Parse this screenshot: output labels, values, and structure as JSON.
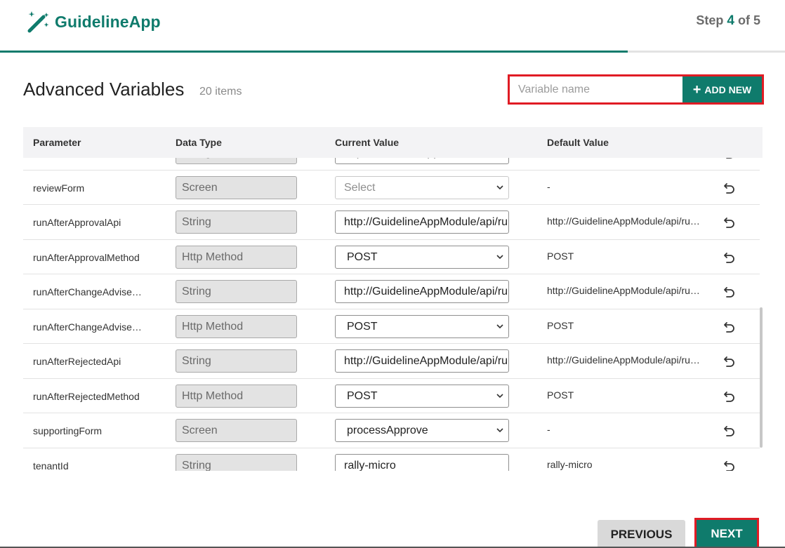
{
  "header": {
    "app_name": "GuidelineApp",
    "step_prefix": "Step",
    "step_current": "4",
    "step_sep": "of",
    "step_total": "5",
    "progress_fraction": 0.8
  },
  "page": {
    "title": "Advanced Variables",
    "count": "20 items"
  },
  "add_new": {
    "placeholder": "Variable name",
    "button_label": "ADD NEW"
  },
  "table": {
    "columns": [
      "Parameter",
      "Data Type",
      "Current Value",
      "Default Value"
    ],
    "rows": [
      {
        "param": "",
        "dtype": "String",
        "cval": "http://GuidelineApp",
        "dval": "",
        "kind": "text"
      },
      {
        "param": "reviewForm",
        "dtype": "Screen",
        "cval": "Select",
        "dval": "-",
        "kind": "placeholder"
      },
      {
        "param": "runAfterApprovalApi",
        "dtype": "String",
        "cval": "http://GuidelineAppModule/api/ru",
        "dval": "http://GuidelineAppModule/api/ru…",
        "kind": "text"
      },
      {
        "param": "runAfterApprovalMethod",
        "dtype": "Http Method",
        "cval": "POST",
        "dval": "POST",
        "kind": "select"
      },
      {
        "param": "runAfterChangeAdvised…",
        "dtype": "String",
        "cval": "http://GuidelineAppModule/api/ru",
        "dval": "http://GuidelineAppModule/api/ru…",
        "kind": "text"
      },
      {
        "param": "runAfterChangeAdvised…",
        "dtype": "Http Method",
        "cval": "POST",
        "dval": "POST",
        "kind": "select"
      },
      {
        "param": "runAfterRejectedApi",
        "dtype": "String",
        "cval": "http://GuidelineAppModule/api/ru",
        "dval": "http://GuidelineAppModule/api/ru…",
        "kind": "text"
      },
      {
        "param": "runAfterRejectedMethod",
        "dtype": "Http Method",
        "cval": "POST",
        "dval": "POST",
        "kind": "select"
      },
      {
        "param": "supportingForm",
        "dtype": "Screen",
        "cval": "processApprove",
        "dval": "-",
        "kind": "select"
      },
      {
        "param": "tenantId",
        "dtype": "String",
        "cval": "rally-micro",
        "dval": "rally-micro",
        "kind": "text"
      }
    ]
  },
  "footer": {
    "previous_label": "PREVIOUS",
    "next_label": "NEXT"
  },
  "colors": {
    "brand": "#0f7b6c",
    "highlight": "#e01b24"
  }
}
